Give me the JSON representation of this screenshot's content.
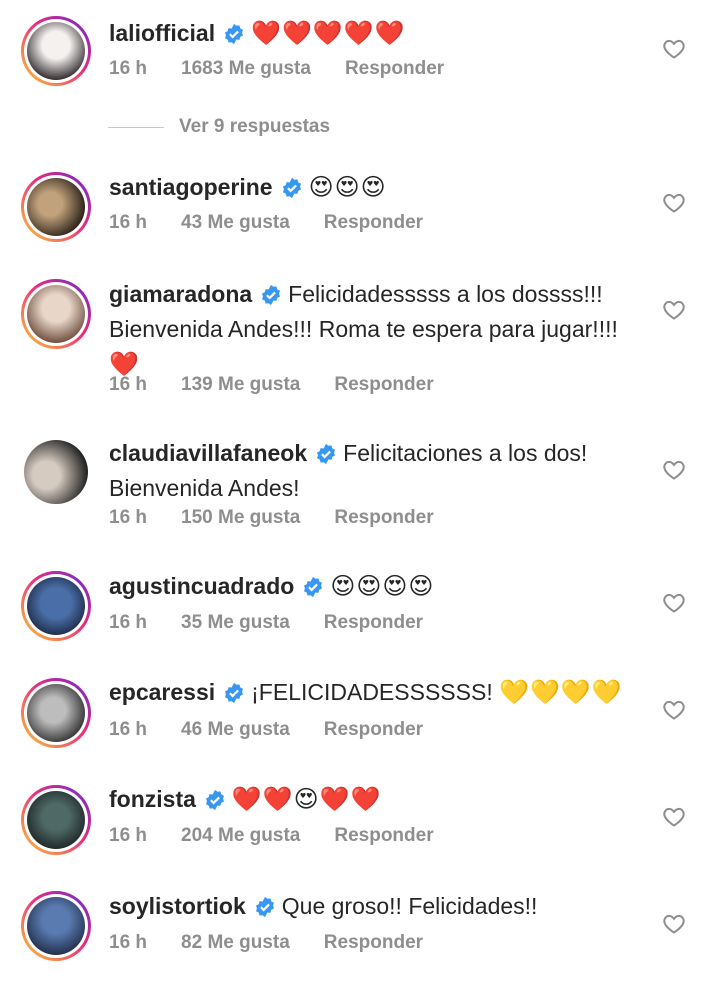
{
  "comments": [
    {
      "username": "laliofficial",
      "text": "",
      "emoji": "❤️❤️❤️❤️❤️",
      "time": "16 h",
      "likes": "1683 Me gusta",
      "reply": "Responder",
      "avatar_colors": [
        "#f4f1ef",
        "#3a3436"
      ]
    },
    {
      "username": "santiagoperine",
      "text": "",
      "emoji": "😍😍😍",
      "time": "16 h",
      "likes": "43 Me gusta",
      "reply": "Responder",
      "avatar_colors": [
        "#c2a27c",
        "#2b2219"
      ]
    },
    {
      "username": "giamaradona",
      "text": "Felicidadesssss a los dossss!!! Bienvenida Andes!!! Roma te espera para jugar!!!!",
      "emoji": "❤️",
      "time": "16 h",
      "likes": "139 Me gusta",
      "reply": "Responder",
      "avatar_colors": [
        "#e8d7c9",
        "#6b4c3b"
      ]
    },
    {
      "username": "claudiavillafaneok",
      "text": "Felicitaciones a los dos! Bienvenida Andes!",
      "emoji": "",
      "time": "16 h",
      "likes": "150 Me gusta",
      "reply": "Responder",
      "avatar_colors": [
        "#d6cbc0",
        "#242424"
      ]
    },
    {
      "username": "agustincuadrado",
      "text": "",
      "emoji": "😍😍😍😍",
      "time": "16 h",
      "likes": "35 Me gusta",
      "reply": "Responder",
      "avatar_colors": [
        "#4a6fa8",
        "#1a2640"
      ]
    },
    {
      "username": "epcaressi",
      "text": "¡FELICIDADESSSSSS!",
      "emoji": "💛💛💛💛",
      "time": "16 h",
      "likes": "46 Me gusta",
      "reply": "Responder",
      "avatar_colors": [
        "#bdbdbd",
        "#2a2a2a"
      ]
    },
    {
      "username": "fonzista",
      "text": "",
      "emoji": "❤️❤️😍❤️❤️",
      "time": "16 h",
      "likes": "204 Me gusta",
      "reply": "Responder",
      "avatar_colors": [
        "#4f6a66",
        "#1c2524"
      ]
    },
    {
      "username": "soylistortiok",
      "text": "Que groso!! Felicidades!!",
      "emoji": "",
      "time": "16 h",
      "likes": "82 Me gusta",
      "reply": "Responder",
      "avatar_colors": [
        "#5a7bb0",
        "#1f2b46"
      ]
    }
  ],
  "view_replies": "Ver 9 respuestas",
  "colors": {
    "verified": "#3897f0",
    "meta": "#8e8e8e",
    "text": "#262626"
  }
}
